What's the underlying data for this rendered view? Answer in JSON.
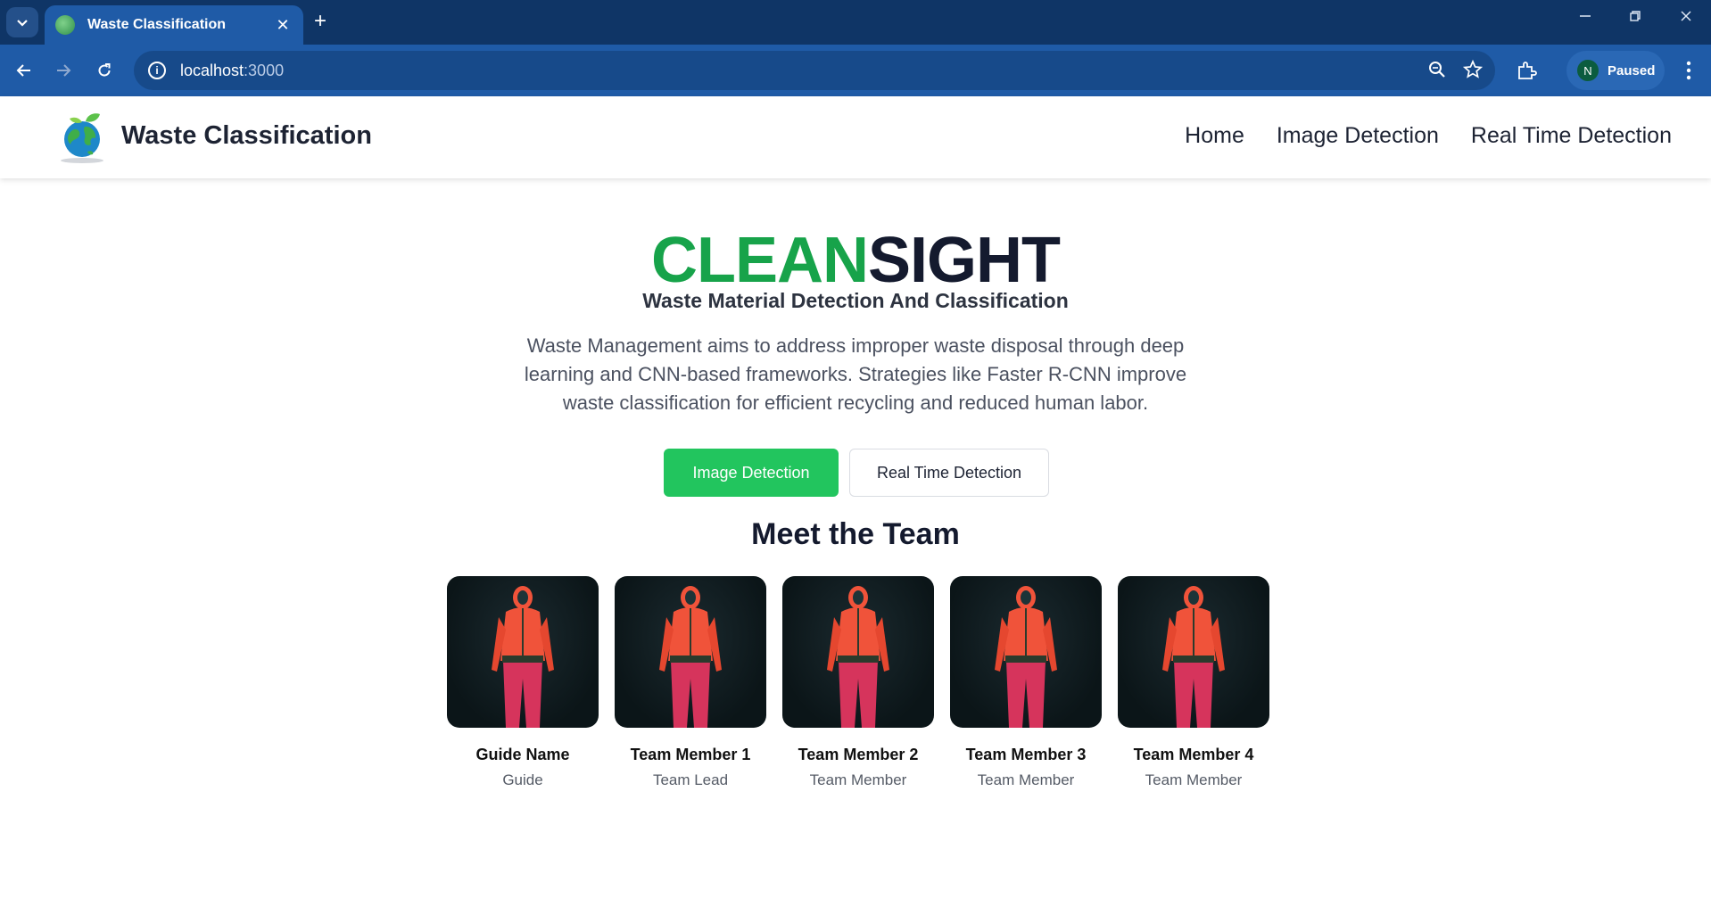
{
  "browser": {
    "tab_title": "Waste Classification",
    "tab_close": "✕",
    "new_tab": "+",
    "url_host": "localhost",
    "url_port": ":3000",
    "profile_initial": "N",
    "profile_status": "Paused"
  },
  "header": {
    "brand": "Waste Classification",
    "nav": [
      "Home",
      "Image Detection",
      "Real Time Detection"
    ]
  },
  "hero": {
    "title_green": "CLEAN",
    "title_dark": "SIGHT",
    "subtitle": "Waste Material Detection And Classification",
    "description": "Waste Management aims to address improper waste disposal through deep learning and CNN-based frameworks. Strategies like Faster R-CNN improve waste classification for efficient recycling and reduced human labor.",
    "primary_button": "Image Detection",
    "secondary_button": "Real Time Detection"
  },
  "team": {
    "title": "Meet the Team",
    "members": [
      {
        "name": "Guide Name",
        "role": "Guide"
      },
      {
        "name": "Team Member 1",
        "role": "Team Lead"
      },
      {
        "name": "Team Member 2",
        "role": "Team Member"
      },
      {
        "name": "Team Member 3",
        "role": "Team Member"
      },
      {
        "name": "Team Member 4",
        "role": "Team Member"
      }
    ]
  },
  "colors": {
    "chrome_dark": "#0f3566",
    "chrome_blue": "#1f5ba7",
    "accent_green": "#22c55e",
    "title_green": "#17a34a",
    "title_dark": "#141a2e"
  },
  "icons": {
    "tab_list": "chevron-down-icon",
    "back": "arrow-left-icon",
    "forward": "arrow-right-icon",
    "reload": "reload-icon",
    "site_info": "info-icon",
    "zoom": "zoom-icon",
    "bookmark": "star-icon",
    "extensions": "puzzle-icon",
    "menu": "kebab-menu-icon",
    "logo": "earth-leaf-logo-icon"
  }
}
